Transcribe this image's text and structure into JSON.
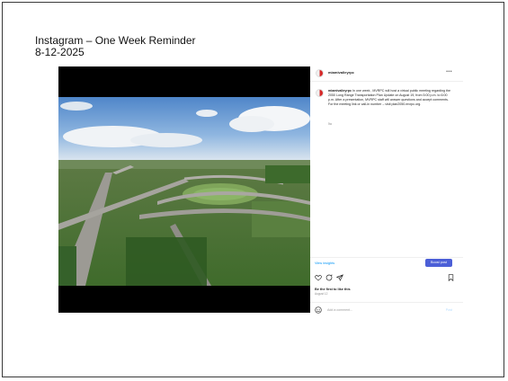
{
  "slide": {
    "title_line1": "Instagram –  One Week Reminder",
    "title_line2": "8-12-2025"
  },
  "post": {
    "username": "miamivalleyrpc",
    "more_label": "•••",
    "caption_user": "miamivalleyrpc",
    "caption_text": "In one week , MVRPC will host a virtual public meeting regarding the 2050 Long Range Transportation Plan Update on August 19, from 5:00 p.m. to 6:00 p.m. After a presentation, MVRPC staff will answer questions and accept comments. For the meeting link or call-in number – visit plan2050.mvrpc.org.",
    "age": "5w",
    "view_insights": "View insights",
    "boost_label": "Boost post",
    "likes_text": "Be the first to like this",
    "date": "August 12",
    "comment_placeholder": "Add a comment...",
    "post_label": "Post"
  },
  "icons": {
    "avatar": "avatar-logo",
    "heart": "heart-icon",
    "comment": "comment-icon",
    "share": "share-icon",
    "bookmark": "bookmark-icon",
    "emoji": "emoji-icon"
  },
  "colors": {
    "link_blue": "#0095f6",
    "boost_button": "#4c5fd7",
    "logo_red": "#d62828"
  }
}
